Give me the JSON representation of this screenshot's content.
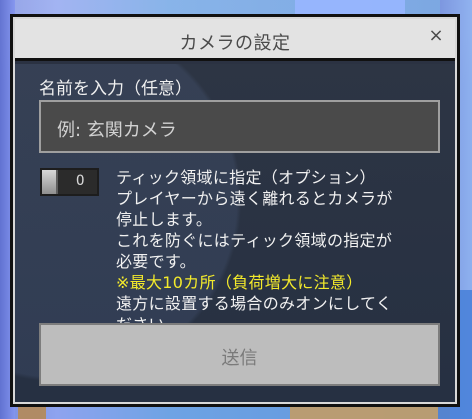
{
  "dialog": {
    "title": "カメラの設定",
    "close_label": "×"
  },
  "form": {
    "name_label": "名前を入力（任意）",
    "name_input_value": "例: 玄関カメラ",
    "toggle_state": "O",
    "option_title": "ティック領域に指定（オプション）",
    "option_line1": "プレイヤーから遠く離れるとカメラが",
    "option_line2": "停止します。",
    "option_line3": "これを防ぐにはティック領域の指定が",
    "option_line4": "必要です。",
    "warning": "※最大10カ所（負荷増大に注意）",
    "option_line5": "遠方に設置する場合のみオンにしてく",
    "option_line6": "ださい。",
    "submit_label": "送信"
  }
}
